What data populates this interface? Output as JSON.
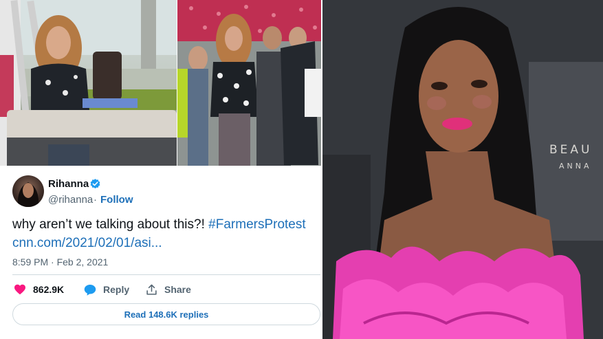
{
  "tweet": {
    "author_name": "Rihanna",
    "author_handle": "@rihanna",
    "separator": "·",
    "follow_label": "Follow",
    "text": "why aren’t we talking about this?! ",
    "hashtag": "#FarmersProtest",
    "link": "cnn.com/2021/02/01/asi...",
    "timestamp": "8:59 PM · Feb 2, 2021",
    "like_count": "862.9K",
    "reply_label": "Reply",
    "share_label": "Share",
    "read_replies_label": "Read 148.6K replies",
    "verified_icon": "verified-badge-icon"
  },
  "backdrop_sign": {
    "line1": "BEAU",
    "line2": "ANNA"
  },
  "colors": {
    "link_blue": "#1d6fb8",
    "like_pink": "#f91880",
    "verified_blue": "#1d9bf0",
    "dress_magenta": "#e43fb0"
  }
}
